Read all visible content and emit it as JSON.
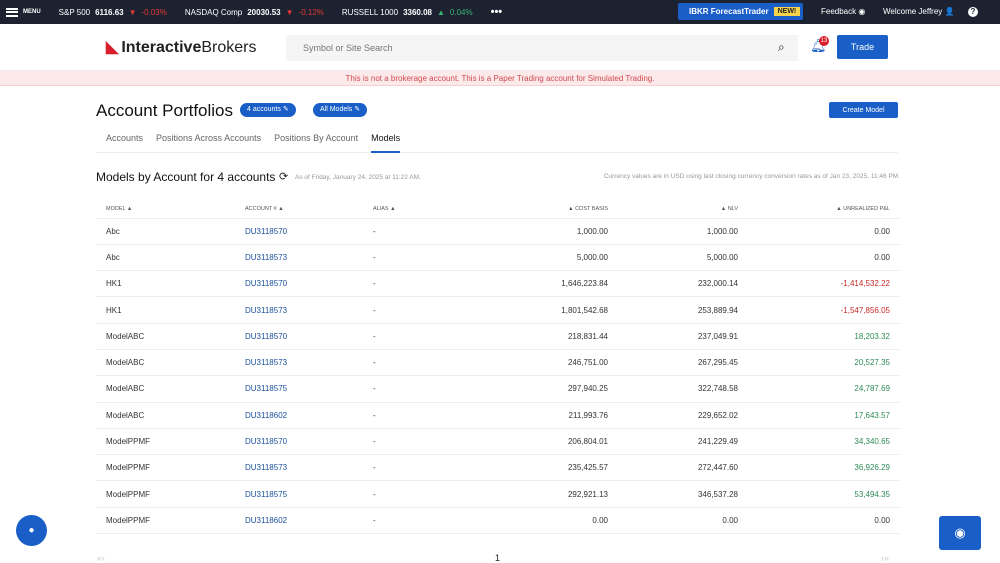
{
  "topbar": {
    "menu": "MENU",
    "tickers": [
      {
        "name": "S&P 500",
        "value": "6116.63",
        "change": "-0.03%",
        "dir": "down"
      },
      {
        "name": "NASDAQ Comp",
        "value": "20030.53",
        "change": "-0.12%",
        "dir": "down"
      },
      {
        "name": "RUSSELL 1000",
        "value": "3360.08",
        "change": "0.04%",
        "dir": "up"
      }
    ],
    "more": "•••",
    "forecast": "IBKR ForecastTrader",
    "new_badge": "NEW!",
    "feedback": "Feedback",
    "welcome": "Welcome Jeffrey",
    "help": "?"
  },
  "header": {
    "logo_bold": "Interactive",
    "logo_rest": "Brokers",
    "search_placeholder": "Symbol or Site Search",
    "notifications": "13",
    "trade": "Trade"
  },
  "warning": "This is not a brokerage account. This is a Paper Trading account for Simulated Trading.",
  "page": {
    "title": "Account Portfolios",
    "accounts_pill": "4 accounts",
    "models_pill": "All Models",
    "create_model": "Create Model",
    "tabs": [
      "Accounts",
      "Positions Across Accounts",
      "Positions By Account",
      "Models"
    ],
    "active_tab": "Models",
    "subtitle": "Models by Account for 4 accounts",
    "as_of": "As of Friday, January 24, 2025 at 11:22 AM.",
    "currency_note": "Currency values are in USD using last closing currency conversion rates as of Jan 23, 2025, 11:46 PM."
  },
  "table": {
    "headers": [
      "MODEL ▲",
      "ACCOUNT # ▲",
      "ALIAS ▲",
      "▲ COST BASIS",
      "▲ NLV",
      "▲ UNREALIZED P&L"
    ],
    "rows": [
      [
        "Abc",
        "DU3118570",
        "-",
        "1,000.00",
        "1,000.00",
        "0.00"
      ],
      [
        "Abc",
        "DU3118573",
        "-",
        "5,000.00",
        "5,000.00",
        "0.00"
      ],
      [
        "HK1",
        "DU3118570",
        "-",
        "1,646,223.84",
        "232,000.14",
        "-1,414,532.22"
      ],
      [
        "HK1",
        "DU3118573",
        "-",
        "1,801,542.68",
        "253,889.94",
        "-1,547,856.05"
      ],
      [
        "ModelABC",
        "DU3118570",
        "-",
        "218,831.44",
        "237,049.91",
        "18,203.32"
      ],
      [
        "ModelABC",
        "DU3118573",
        "-",
        "246,751.00",
        "267,295.45",
        "20,527.35"
      ],
      [
        "ModelABC",
        "DU3118575",
        "-",
        "297,940.25",
        "322,748.58",
        "24,787.69"
      ],
      [
        "ModelABC",
        "DU3118602",
        "-",
        "211,993.76",
        "229,652.02",
        "17,643.57"
      ],
      [
        "ModelPPMF",
        "DU3118570",
        "-",
        "206,804.01",
        "241,229.49",
        "34,340.65"
      ],
      [
        "ModelPPMF",
        "DU3118573",
        "-",
        "235,425.57",
        "272,447.60",
        "36,926.29"
      ],
      [
        "ModelPPMF",
        "DU3118575",
        "-",
        "292,921.13",
        "346,537.28",
        "53,494.35"
      ],
      [
        "ModelPPMF",
        "DU3118602",
        "-",
        "0.00",
        "0.00",
        "0.00"
      ]
    ]
  },
  "pager": {
    "prev": "«‹",
    "page": "1",
    "next": "›»"
  },
  "colors": {
    "accent": "#1a5fc8",
    "negative": "#c62828",
    "positive": "#2e8b57",
    "topbar": "#1c2230"
  }
}
